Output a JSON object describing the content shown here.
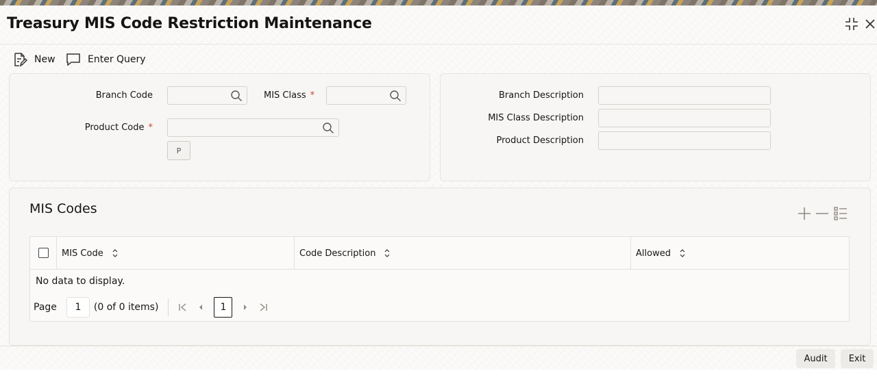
{
  "window": {
    "title": "Treasury MIS Code Restriction Maintenance",
    "icons": [
      "minimize-icon",
      "close-icon"
    ]
  },
  "toolbar": {
    "new_label": "New",
    "enter_query_label": "Enter Query"
  },
  "form": {
    "branch_code_label": "Branch Code",
    "mis_class_label": "MIS Class",
    "product_code_label": "Product Code",
    "required_mark": "*",
    "p_button_label": "P",
    "branch_code_value": "",
    "mis_class_value": "",
    "product_code_value": ""
  },
  "descriptions": {
    "branch_description_label": "Branch Description",
    "mis_class_description_label": "MIS Class Description",
    "product_description_label": "Product Description"
  },
  "mis_codes": {
    "title": "MIS Codes",
    "columns": [
      "MIS Code",
      "Code Description",
      "Allowed"
    ],
    "rows": [],
    "empty_text": "No data to display.",
    "pager": {
      "page_label": "Page",
      "page_value": "1",
      "items_text": "(0 of 0 items)",
      "current_page": "1"
    }
  },
  "footer": {
    "audit_label": "Audit",
    "exit_label": "Exit"
  },
  "colors": {
    "required": "#c74634",
    "panel": "#f7f6f4",
    "text": "#161513"
  }
}
